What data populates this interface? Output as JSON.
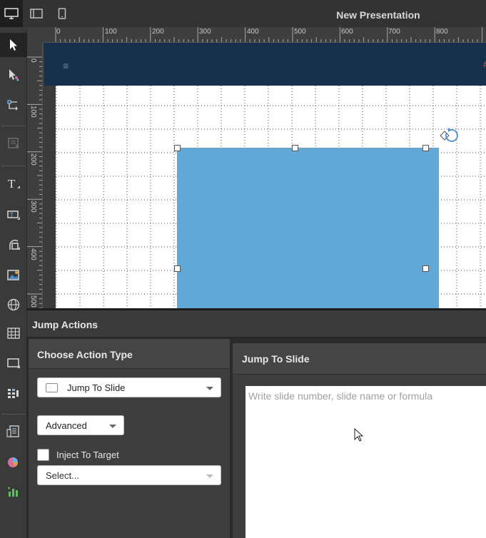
{
  "window": {
    "title": "New Presentation"
  },
  "view_modes": [
    "desktop",
    "panel",
    "phone"
  ],
  "ruler": {
    "horizontal": [
      "0",
      "100",
      "200",
      "300",
      "400",
      "500",
      "600",
      "700",
      "800"
    ],
    "vertical": [
      "0",
      "100",
      "200",
      "300",
      "400",
      "500"
    ]
  },
  "canvas": {
    "header_mark": "#"
  },
  "tools": [
    "select-arrow-icon",
    "touch-select-icon",
    "connector-icon",
    "form-icon",
    "text-icon",
    "button-icon",
    "shape-icon",
    "image-icon",
    "web-icon",
    "table-icon",
    "screen-icon",
    "grid-widget-icon",
    "report-icon",
    "pie-chart-icon",
    "bar-chart-icon"
  ],
  "jump_actions": {
    "title": "Jump Actions",
    "choose_action_type": {
      "title": "Choose Action Type",
      "selected_action": "Jump To Slide",
      "mode": "Advanced",
      "inject_label": "Inject To Target",
      "inject_checked": false,
      "target_placeholder": "Select..."
    },
    "jump_to_slide": {
      "title": "Jump To Slide",
      "placeholder": "Write slide number, slide name or formula",
      "value": ""
    }
  },
  "colors": {
    "accent_shape": "#62a8d6",
    "slide_header": "#14304a",
    "rotate_handle": "#4a90d0"
  }
}
